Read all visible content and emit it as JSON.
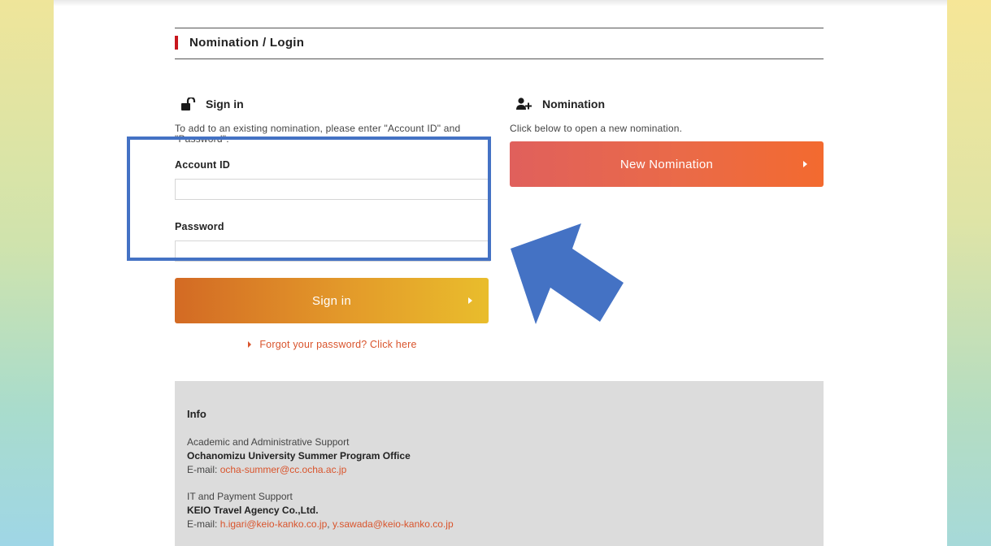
{
  "page": {
    "section_title": "Nomination / Login"
  },
  "signin": {
    "title": "Sign in",
    "description": "To add to an existing nomination, please enter \"Account ID\" and \"Password\".",
    "account_id_label": "Account ID",
    "account_id_value": "",
    "password_label": "Password",
    "password_value": "",
    "button_label": "Sign in",
    "forgot_link": "Forgot your password? Click here"
  },
  "nomination": {
    "title": "Nomination",
    "description": "Click below to open a new nomination.",
    "button_label": "New Nomination"
  },
  "info": {
    "title": "Info",
    "groups": [
      {
        "heading": "Academic and Administrative Support",
        "org": "Ochanomizu University Summer Program Office",
        "email_prefix": "E-mail:",
        "emails": [
          "ocha-summer@cc.ocha.ac.jp"
        ]
      },
      {
        "heading": "IT and Payment Support",
        "org": "KEIO Travel Agency Co.,Ltd.",
        "email_prefix": "E-mail:",
        "emails": [
          "h.igari@keio-kanko.co.jp",
          "y.sawada@keio-kanko.co.jp"
        ]
      }
    ]
  },
  "icons": {
    "signin": "unlock-icon",
    "nomination": "add-user-icon"
  },
  "colors": {
    "accent_red": "#c8161d",
    "link": "#d9542c",
    "annotation": "#4472c4"
  }
}
